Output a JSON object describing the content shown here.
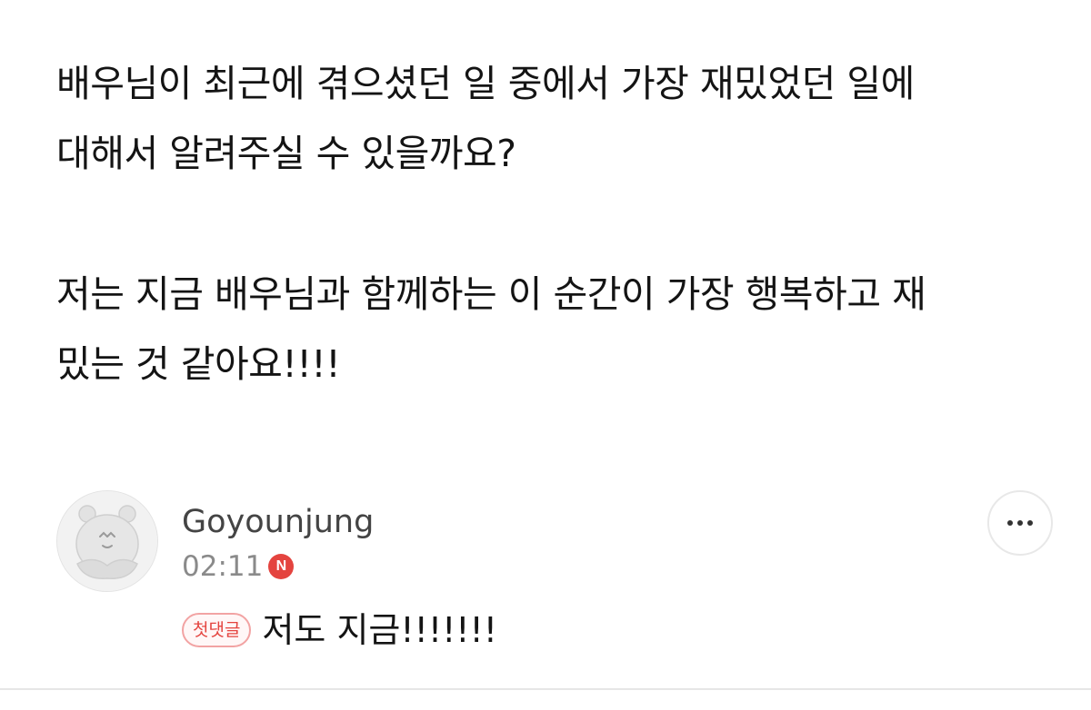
{
  "post": {
    "paragraph1_line1": "배우님이 최근에 겪으셨던 일 중에서 가장 재밌었던 일에",
    "paragraph1_line2": "대해서 알려주실 수 있을까요?",
    "paragraph2_line1": "저는 지금 배우님과 함께하는 이 순간이 가장 행복하고 재",
    "paragraph2_line2": "밌는 것 같아요!!!!"
  },
  "comment": {
    "author": "Goyounjung",
    "time": "02:11",
    "new_badge": "N",
    "first_comment_badge": "첫댓글",
    "text": "저도 지금!!!!!!!",
    "avatar_icon": "default-profile-avatar-icon",
    "more_icon": "more-horizontal-icon"
  },
  "colors": {
    "accent_red": "#e4443f",
    "badge_border": "#f2a3a3",
    "meta_gray": "#8a8a8a"
  }
}
